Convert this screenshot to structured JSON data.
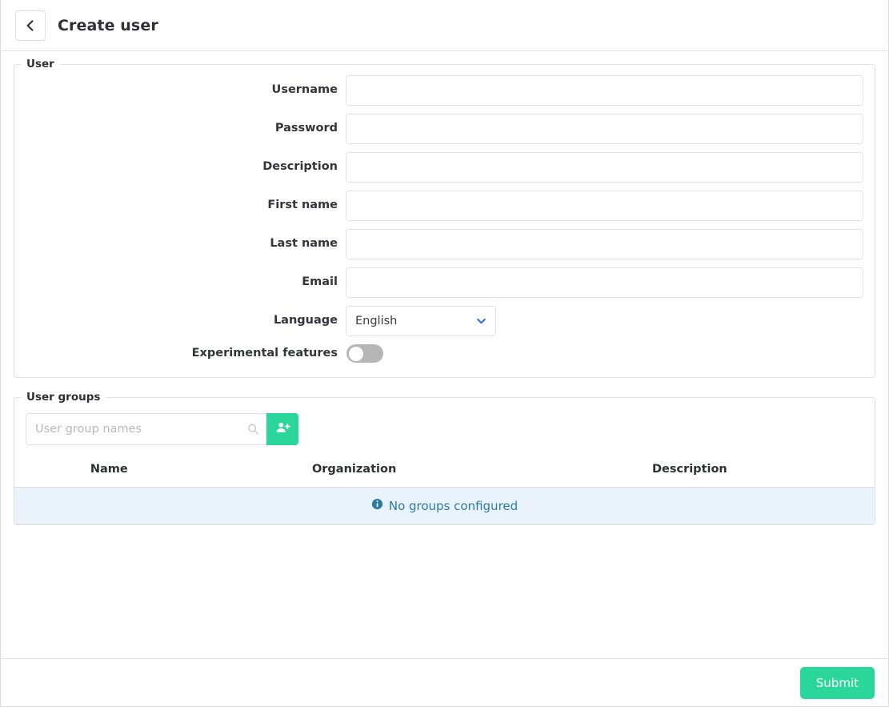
{
  "header": {
    "title": "Create user",
    "back_icon": "chevron-left-icon"
  },
  "user_panel": {
    "legend": "User",
    "fields": [
      {
        "label": "Username",
        "value": "",
        "placeholder": "",
        "type": "text"
      },
      {
        "label": "Password",
        "value": "",
        "placeholder": "",
        "type": "password"
      },
      {
        "label": "Description",
        "value": "",
        "placeholder": "",
        "type": "text"
      },
      {
        "label": "First name",
        "value": "",
        "placeholder": "",
        "type": "text"
      },
      {
        "label": "Last name",
        "value": "",
        "placeholder": "",
        "type": "text"
      },
      {
        "label": "Email",
        "value": "",
        "placeholder": "",
        "type": "text"
      }
    ],
    "language": {
      "label": "Language",
      "selected": "English",
      "options": [
        "English"
      ],
      "chevron_icon": "chevron-down-icon",
      "chevron_color": "#3b76e0"
    },
    "experimental": {
      "label": "Experimental features",
      "enabled": false
    }
  },
  "user_groups_panel": {
    "legend": "User groups",
    "search": {
      "placeholder": "User group names",
      "value": "",
      "search_icon": "magnifier-icon",
      "add_icon": "user-add-icon",
      "add_button_color": "#2bd69b"
    },
    "table": {
      "columns": [
        "Name",
        "Organization",
        "Description"
      ],
      "rows": [],
      "empty_message": "No groups configured",
      "empty_icon": "info-circle-icon",
      "empty_color": "#2b7ca3",
      "empty_background": "#eaf3fb"
    }
  },
  "footer": {
    "submit_label": "Submit",
    "submit_color": "#2bd69b"
  }
}
